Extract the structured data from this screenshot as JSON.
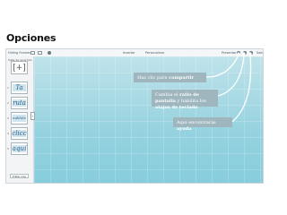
{
  "page": {
    "title": "Opciones"
  },
  "topbar": {
    "project_name": "Hiding Frames",
    "center_label": "Insertar",
    "center_label2": "Personalizar",
    "right_label": "Presentar",
    "exit_label": "Salir"
  },
  "sidebar": {
    "header_label": "Vista de recorrido",
    "thumbnails": [
      {
        "num": "1",
        "text": "Ta"
      },
      {
        "num": "2",
        "text": "ruta"
      },
      {
        "num": "3",
        "text": "nakhile"
      },
      {
        "num": "4",
        "text": "clicc"
      },
      {
        "num": "5",
        "text": "aquí"
      }
    ],
    "add_button": "Editar ruta"
  },
  "tips": {
    "share_pre": "Haz clic para ",
    "share_bold": "compartir",
    "ratio_pre": "Cambia el ",
    "ratio_bold": "ratio de pantalla",
    "ratio_mid": " y habilita los ",
    "ratio_bold2": "atajos de teclado",
    "help_pre": "Aquí encontrarás ",
    "help_bold": "ayuda"
  },
  "colors": {
    "canvas": "#9bd3e0",
    "tip_bg": "#9fb6bf",
    "arrow": "#ffffff"
  },
  "icons": [
    "home-icon",
    "undo-icon",
    "redo-icon",
    "share-icon",
    "settings-icon",
    "help-icon",
    "exit-icon"
  ]
}
